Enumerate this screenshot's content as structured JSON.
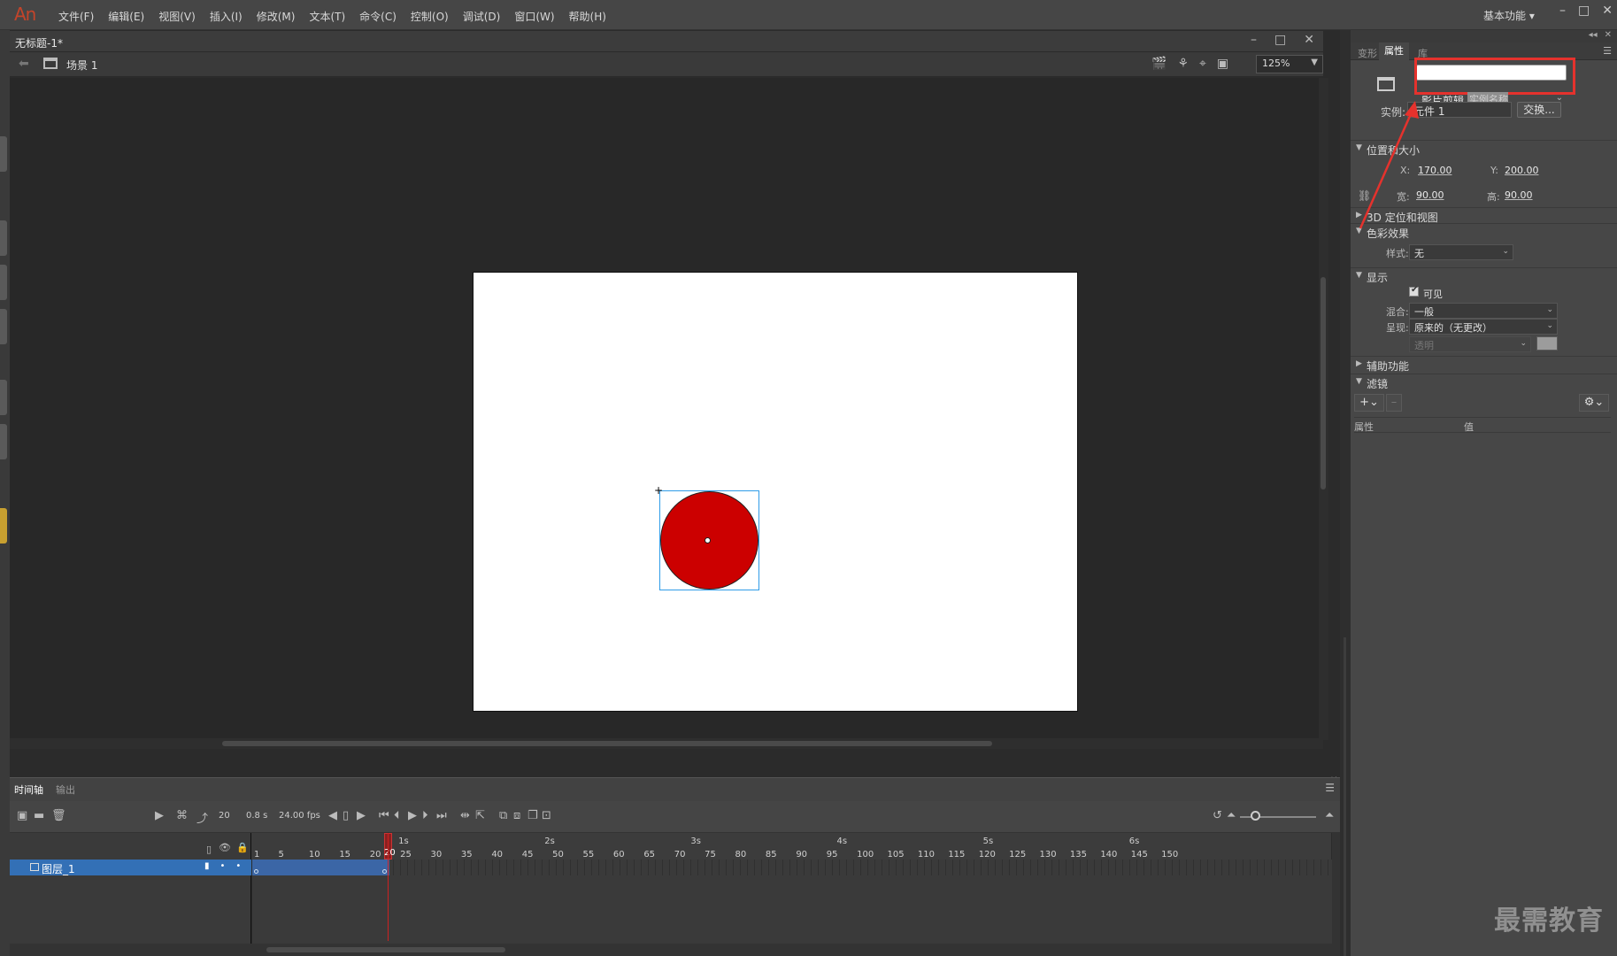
{
  "app": {
    "logo": "An",
    "menus": [
      "文件(F)",
      "编辑(E)",
      "视图(V)",
      "插入(I)",
      "修改(M)",
      "文本(T)",
      "命令(C)",
      "控制(O)",
      "调试(D)",
      "窗口(W)",
      "帮助(H)"
    ],
    "workspace": "基本功能 ▾",
    "window_controls": [
      "–",
      "□",
      "✕"
    ]
  },
  "document": {
    "title": "无标题-1*",
    "scene": "场景 1",
    "zoom": "125%",
    "controls": [
      "–",
      "□",
      "✕"
    ]
  },
  "stage": {
    "object": "circle",
    "fill_color": "#cc0000",
    "selection_color": "#2f9ce8"
  },
  "timeline": {
    "tabs": [
      "时间轴",
      "输出"
    ],
    "current_frame": "20",
    "time": "0.8 s",
    "fps": "24.00 fps",
    "seconds": [
      "1s",
      "2s",
      "3s",
      "4s",
      "5s",
      "6s"
    ],
    "frame_ticks": [
      "1",
      "5",
      "10",
      "15",
      "20",
      "25",
      "30",
      "35",
      "40",
      "45",
      "50",
      "55",
      "60",
      "65",
      "70",
      "75",
      "80",
      "85",
      "90",
      "95",
      "100",
      "105",
      "110",
      "115",
      "120",
      "125",
      "130",
      "135",
      "140",
      "145",
      "150"
    ],
    "playhead_frame": "20",
    "layer_name": "图层_1"
  },
  "properties": {
    "tabs": [
      "变形",
      "属性",
      "库"
    ],
    "instance_name_placeholder": "",
    "symbol_type": "影片剪辑",
    "symbol_type_hint": "实例名称",
    "instance_label": "实例:",
    "instance_value": "元件 1",
    "swap_label": "交换...",
    "position_section": "位置和大小",
    "x_label": "X:",
    "x_value": "170.00",
    "y_label": "Y:",
    "y_value": "200.00",
    "w_label": "宽:",
    "w_value": "90.00",
    "h_label": "高:",
    "h_value": "90.00",
    "section_3d": "3D 定位和视图",
    "color_section": "色彩效果",
    "style_label": "样式:",
    "style_value": "无",
    "display_section": "显示",
    "visible_label": "可见",
    "blend_label": "混合:",
    "blend_value": "一般",
    "render_label": "呈现:",
    "render_value": "原来的（无更改）",
    "transparent_value": "透明",
    "accessibility_section": "辅助功能",
    "filters_section": "滤镜",
    "filter_col_property": "属性",
    "filter_col_value": "值",
    "highlight_color": "#e5322d"
  },
  "watermark": "最需教育"
}
